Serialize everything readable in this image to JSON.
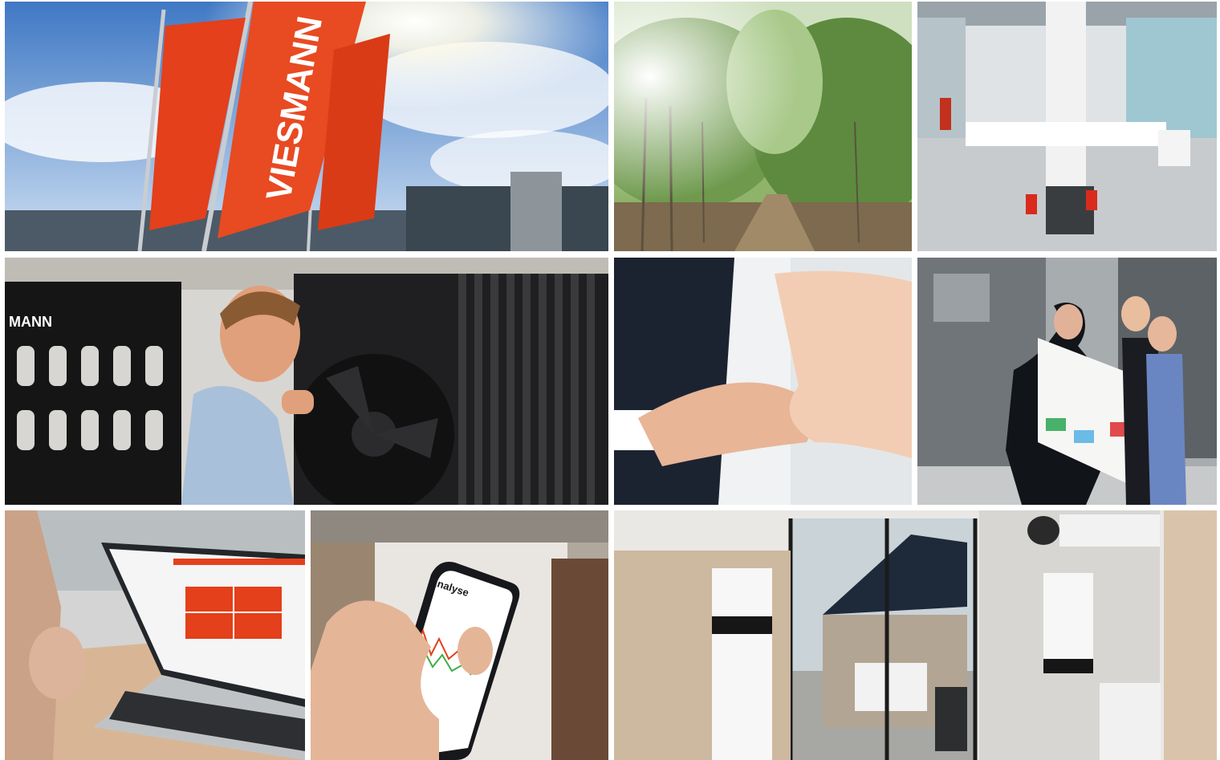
{
  "collage": {
    "tiles": [
      {
        "name": "flags-headquarters",
        "brand_text": "VIESMANN"
      },
      {
        "name": "forest-path"
      },
      {
        "name": "factory-hall"
      },
      {
        "name": "technician-heat-pump",
        "brand_text": "MANN"
      },
      {
        "name": "handshake"
      },
      {
        "name": "engineers-blueprint"
      },
      {
        "name": "laptop-dashboard"
      },
      {
        "name": "smartphone-app",
        "app_title": "Analyse"
      },
      {
        "name": "home-energy-system"
      }
    ]
  },
  "colors": {
    "brand_red": "#e3401b",
    "sky": "#5b8fd0",
    "forest": "#6f9a4e",
    "factory_floor": "#cfd2d4",
    "wall_white": "#f4f4f2",
    "wood": "#cdb8a0"
  }
}
